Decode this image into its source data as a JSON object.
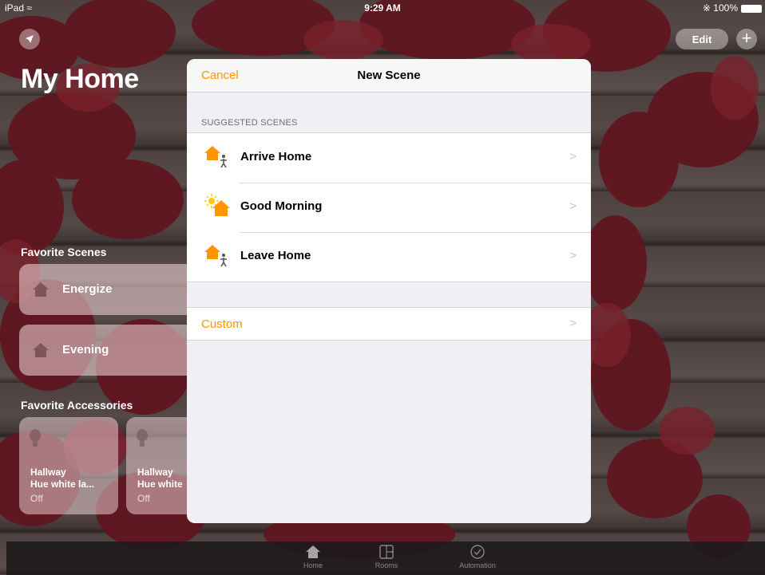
{
  "status_bar": {
    "device": "iPad",
    "time": "9:29 AM",
    "battery": "100%"
  },
  "home": {
    "title": "My Home",
    "edit_label": "Edit",
    "add_label": "+",
    "favorite_scenes_header": "Favorite Scenes",
    "favorite_scenes": [
      {
        "label": "Energize"
      },
      {
        "label": "Evening"
      }
    ],
    "favorite_accessories_header": "Favorite Accessories",
    "favorite_accessories": [
      {
        "room": "Hallway",
        "name": "Hue white la...",
        "state": "Off"
      },
      {
        "room": "Hallway",
        "name": "Hue white",
        "state": "Off"
      }
    ]
  },
  "tabbar": {
    "tabs": [
      {
        "label": "Home",
        "icon": "house-icon"
      },
      {
        "label": "Rooms",
        "icon": "rooms-icon"
      },
      {
        "label": "Automation",
        "icon": "clock-check-icon"
      }
    ]
  },
  "sheet": {
    "cancel_label": "Cancel",
    "title": "New Scene",
    "suggested_header": "SUGGESTED SCENES",
    "suggested": [
      {
        "label": "Arrive Home",
        "icon": "arrive-home-icon"
      },
      {
        "label": "Good Morning",
        "icon": "good-morning-icon"
      },
      {
        "label": "Leave Home",
        "icon": "leave-home-icon"
      }
    ],
    "custom_label": "Custom",
    "chevron": ">"
  },
  "colors": {
    "accent": "#ff9500",
    "sheet_background": "#efeff4",
    "row_background": "#ffffff"
  }
}
